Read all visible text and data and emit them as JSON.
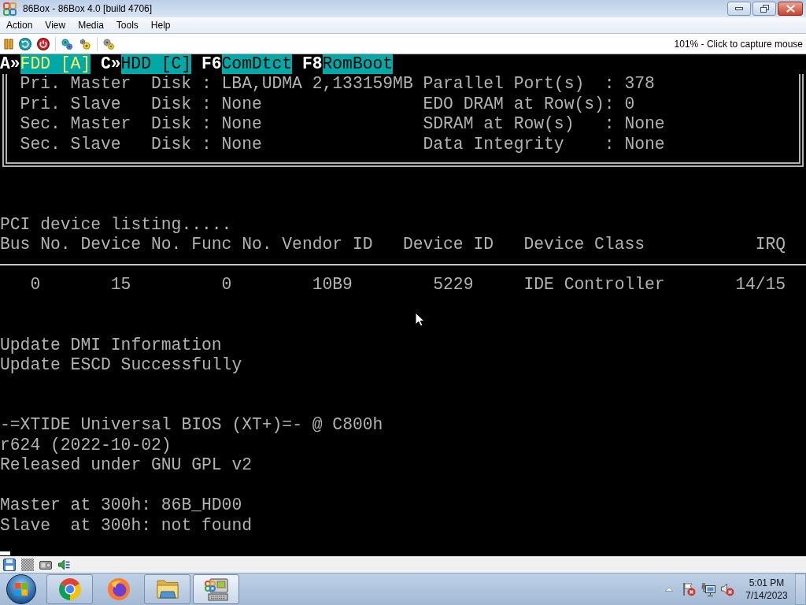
{
  "window": {
    "title": "86Box - 86Box 4.0 [build 4706]"
  },
  "menu": [
    "Action",
    "View",
    "Media",
    "Tools",
    "Help"
  ],
  "toolbar": {
    "status_text": "101% - Click to capture mouse"
  },
  "screen": {
    "boot_keys": [
      {
        "key": "A»",
        "label": "FDD [A]",
        "selected": true
      },
      {
        "key": "C»",
        "label": "HDD [C]",
        "selected": false
      },
      {
        "key": "F6",
        "label": "ComDtct",
        "selected": false
      },
      {
        "key": "F8",
        "label": "RomBoot",
        "selected": false
      }
    ],
    "info_rows": [
      {
        "drive": "Pri. Master",
        "type": "Disk",
        "separator": ":",
        "value": "LBA,UDMA 2,133159MB",
        "setting": "Parallel Port(s)",
        "setting_separator": ":",
        "setting_value": "378"
      },
      {
        "drive": "Pri. Slave",
        "type": "Disk",
        "separator": ":",
        "value": "None",
        "setting": "EDO DRAM at Row(s)",
        "setting_separator": ":",
        "setting_value": "0"
      },
      {
        "drive": "Sec. Master",
        "type": "Disk",
        "separator": ":",
        "value": "None",
        "setting": "SDRAM at Row(s)",
        "setting_separator": ":",
        "setting_value": "None"
      },
      {
        "drive": "Sec. Slave",
        "type": "Disk",
        "separator": ":",
        "value": "None",
        "setting": "Data Integrity",
        "setting_separator": ":",
        "setting_value": "None"
      }
    ],
    "pci_title": "PCI device listing.....",
    "pci_table": {
      "columns": [
        "Bus No.",
        "Device No.",
        "Func No.",
        "Vendor ID",
        "Device ID",
        "Device Class",
        "IRQ"
      ],
      "rows": [
        [
          "0",
          "15",
          "0",
          "10B9",
          "5229",
          "IDE Controller",
          "14/15"
        ]
      ]
    },
    "messages": [
      "Update DMI Information",
      "Update ESCD Successfully"
    ],
    "option_rom": [
      "-=XTIDE Universal BIOS (XT+)=- @ C800h",
      "r624 (2022-10-02)",
      "Released under GNU GPL v2"
    ],
    "drives": [
      "Master at 300h: 86B_HD00",
      "Slave  at 300h: not found"
    ]
  },
  "taskbar": {
    "buttons": [
      {
        "kind": "globe",
        "open": true,
        "selected": false
      },
      {
        "kind": "fox",
        "open": false,
        "selected": false
      },
      {
        "kind": "folder",
        "open": true,
        "selected": false
      },
      {
        "kind": "computer",
        "open": true,
        "selected": true
      }
    ],
    "clock": {
      "time": "5:01 PM",
      "date": "7/14/2023"
    }
  }
}
